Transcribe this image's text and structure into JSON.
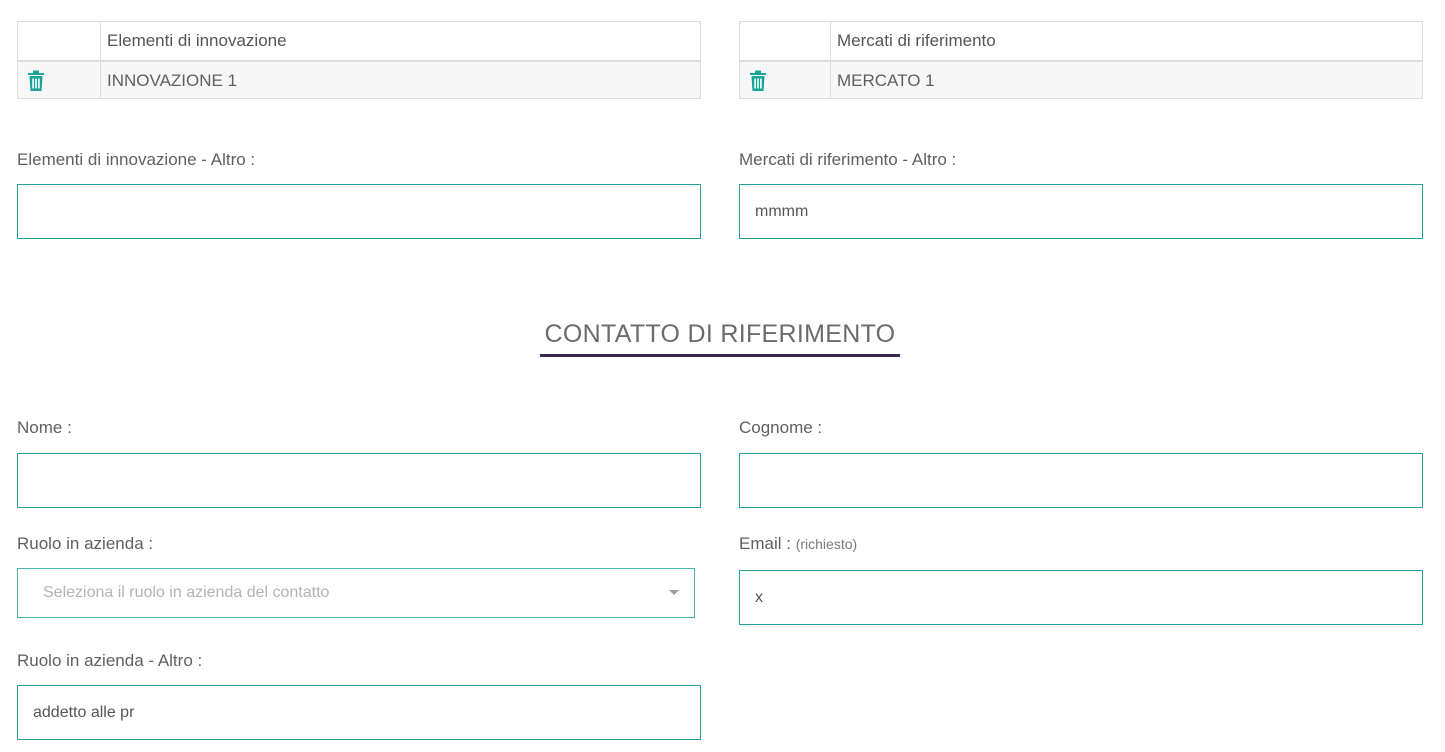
{
  "tables": {
    "innovazione": {
      "header": "Elementi di innovazione",
      "rows": [
        {
          "value": "INNOVAZIONE 1",
          "action_icon": "trash-icon"
        }
      ]
    },
    "mercati": {
      "header": "Mercati di riferimento",
      "rows": [
        {
          "value": "MERCATO 1",
          "action_icon": "trash-icon"
        }
      ]
    }
  },
  "fields": {
    "innovazione_altro": {
      "label": "Elementi di innovazione - Altro :",
      "value": ""
    },
    "mercati_altro": {
      "label": "Mercati di riferimento - Altro :",
      "value": "mmmm"
    },
    "nome": {
      "label": "Nome :",
      "value": ""
    },
    "cognome": {
      "label": "Cognome :",
      "value": ""
    },
    "ruolo": {
      "label": "Ruolo in azienda :",
      "placeholder": "Seleziona il ruolo in azienda del contatto"
    },
    "email": {
      "label": "Email :",
      "required_note": "(richiesto)",
      "value": "x"
    },
    "ruolo_altro": {
      "label": "Ruolo in azienda - Altro :",
      "value": "addetto alle pr"
    }
  },
  "section": {
    "title": "CONTATTO DI RIFERIMENTO"
  },
  "colors": {
    "accent": "#1fa19a",
    "title_underline": "#3b2a4f",
    "icon": "#17a398"
  }
}
